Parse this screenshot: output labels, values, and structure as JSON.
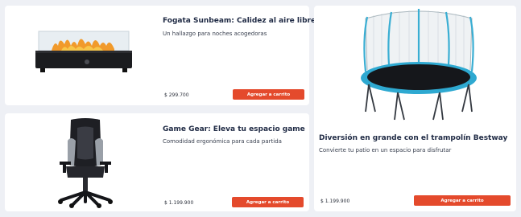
{
  "products": [
    {
      "title": "Fogata Sunbeam: Calidez al aire libre",
      "subtitle": "Un hallazgo para noches acogedoras",
      "price": "$ 299.700",
      "button_label": "Agregar a carrito",
      "image_icon": "fire-pit-image"
    },
    {
      "title": "Game Gear: Eleva tu espacio game",
      "subtitle": "Comodidad ergonómica para cada partida",
      "price": "$ 1.199.900",
      "button_label": "Agregar a carrito",
      "image_icon": "gaming-chair-image"
    },
    {
      "title": "Diversión en grande con el trampolín Bestway",
      "subtitle": "Convierte tu patio en un espacio para disfrutar",
      "price": "$ 1.199.900",
      "button_label": "Agregar a carrito",
      "image_icon": "trampoline-image"
    }
  ],
  "colors": {
    "accent": "#e44a2c",
    "background": "#eef0f5",
    "card": "#ffffff",
    "title": "#1f2a44"
  }
}
